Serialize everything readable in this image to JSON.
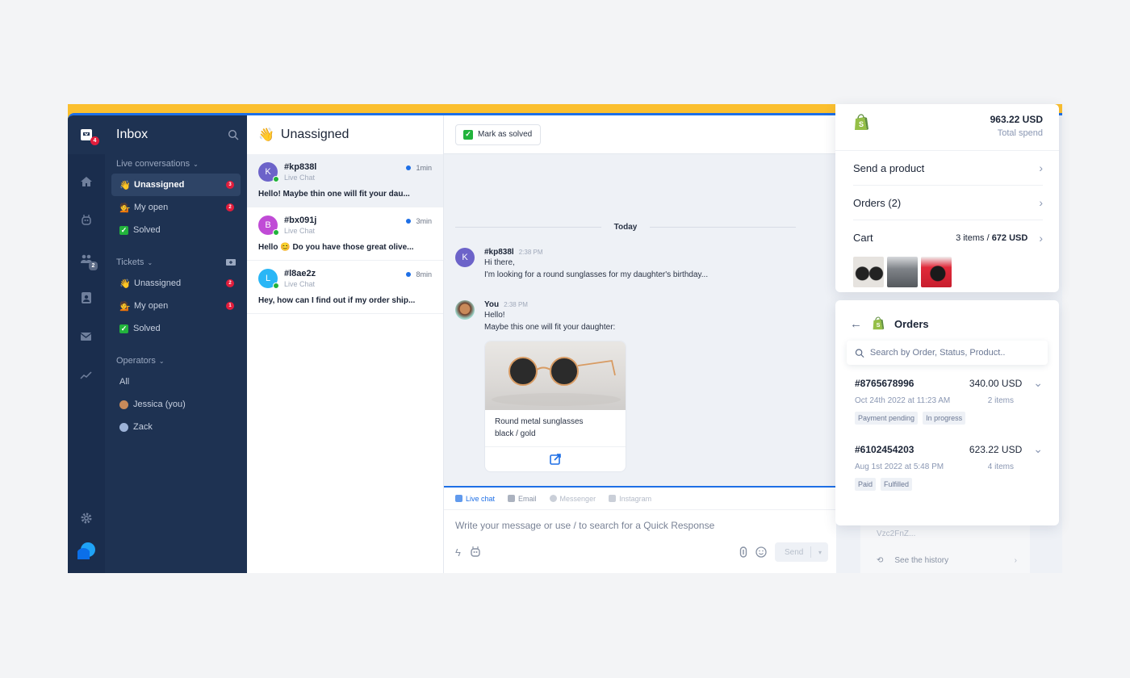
{
  "rail": {
    "inbox_badge": "4",
    "team_badge": "2",
    "items": [
      "inbox-icon",
      "home-icon",
      "bot-icon",
      "team-icon",
      "contacts-icon",
      "mail-icon",
      "analytics-icon"
    ]
  },
  "sidebar": {
    "title": "Inbox",
    "live_section": "Live conversations",
    "live_items": [
      {
        "emoji": "👋",
        "label": "Unassigned",
        "count": "3",
        "active": true
      },
      {
        "emoji": "💁",
        "label": "My open",
        "count": "2"
      },
      {
        "emoji": "✓",
        "label": "Solved",
        "count": ""
      }
    ],
    "tickets_section": "Tickets",
    "ticket_items": [
      {
        "emoji": "👋",
        "label": "Unassigned",
        "count": "2"
      },
      {
        "emoji": "💁",
        "label": "My open",
        "count": "1"
      },
      {
        "emoji": "✓",
        "label": "Solved",
        "count": ""
      }
    ],
    "operators_section": "Operators",
    "operators": [
      {
        "label": "All"
      },
      {
        "label": "Jessica (you)"
      },
      {
        "label": "Zack"
      }
    ]
  },
  "convlist": {
    "title": "Unassigned",
    "emoji": "👋",
    "items": [
      {
        "initial": "K",
        "color": "#6c63c9",
        "id": "#kp838l",
        "channel": "Live Chat",
        "time": "1min",
        "preview": "Hello! Maybe thin one will fit your dau..."
      },
      {
        "initial": "B",
        "color": "#c04bd6",
        "id": "#bx091j",
        "channel": "Live Chat",
        "time": "3min",
        "preview": "Hello 😊 Do you have those great olive..."
      },
      {
        "initial": "L",
        "color": "#29b6f6",
        "id": "#l8ae2z",
        "channel": "Live Chat",
        "time": "8min",
        "preview": "Hey, how can I find out if my order ship..."
      }
    ]
  },
  "chat": {
    "mark_solved": "Mark as solved",
    "day": "Today",
    "messages": [
      {
        "author": "#kp838l",
        "time": "2:38 PM",
        "lines": [
          "Hi there,",
          "I'm looking for a round sunglasses for my daughter's birthday..."
        ]
      },
      {
        "author": "You",
        "time": "2:38 PM",
        "lines": [
          "Hello!",
          "Maybe this one will fit your daughter:"
        ]
      }
    ],
    "product": {
      "name_line1": "Round metal sunglasses",
      "name_line2": "black / gold"
    },
    "channels": [
      "Live chat",
      "Email",
      "Messenger",
      "Instagram"
    ],
    "composer_placeholder": "Write your message or use / to search for a Quick Response",
    "send": "Send"
  },
  "shop": {
    "total": "963.22 USD",
    "total_label": "Total spend",
    "send_product": "Send a product",
    "orders": "Orders (2)",
    "cart": "Cart",
    "cart_count": "3 items / ",
    "cart_total": "672 USD"
  },
  "orders_panel": {
    "title": "Orders",
    "search_placeholder": "Search by Order, Status, Product..",
    "orders": [
      {
        "id": "#8765678996",
        "amount": "340.00 USD",
        "date": "Oct 24th 2022 at 11:23 AM",
        "items": "2 items",
        "tags": [
          "Payment pending",
          "In progress"
        ]
      },
      {
        "id": "#6102454203",
        "amount": "623.22 USD",
        "date": "Aug 1st 2022 at 5:48 PM",
        "items": "4 items",
        "tags": [
          "Paid",
          "Fulfilled"
        ]
      }
    ]
  },
  "background_panel": {
    "snippet": "Vzc2FnZ...",
    "history": "See the history"
  },
  "colors": {
    "accent": "#1e6fe6",
    "frame": "#fbbf2e",
    "rail": "#1a2d4d",
    "sidebar": "#1e3252",
    "badge": "#e11d3c",
    "success": "#22b33c"
  }
}
